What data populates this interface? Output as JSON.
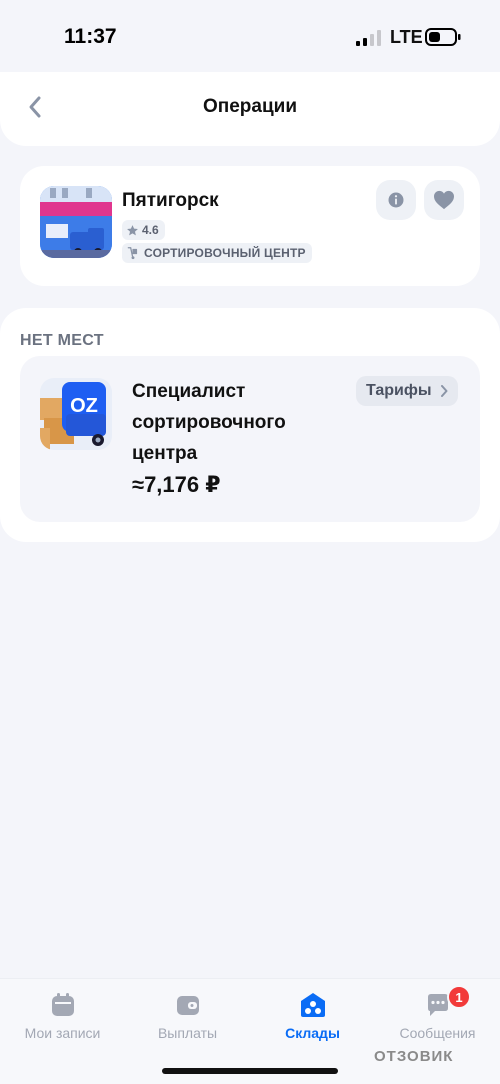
{
  "status_bar": {
    "time": "11:37",
    "network": "LTE"
  },
  "header": {
    "title": "Операции",
    "back_icon": "chevron-left-icon"
  },
  "warehouse": {
    "name": "Пятигорск",
    "rating": "4.6",
    "type": "СОРТИРОВОЧНЫЙ ЦЕНТР",
    "info_icon": "info-icon",
    "favorite_icon": "heart-icon"
  },
  "section": {
    "title": "НЕТ МЕСТ"
  },
  "job": {
    "title": "Специалист сортировочного центра",
    "salary": "≈7,176 ₽",
    "tariffs_label": "Тарифы",
    "logo_text": "OZ"
  },
  "tabs": [
    {
      "label": "Мои записи",
      "icon": "calendar-icon",
      "active": false
    },
    {
      "label": "Выплаты",
      "icon": "wallet-icon",
      "active": false
    },
    {
      "label": "Склады",
      "icon": "warehouses-icon",
      "active": true
    },
    {
      "label": "Сообщения",
      "icon": "chat-icon",
      "active": false,
      "badge": "1"
    }
  ],
  "watermark": "ОТЗОВИК",
  "colors": {
    "accent": "#0a6cf5",
    "badge": "#f23a3a",
    "background": "#f4f5fa"
  }
}
